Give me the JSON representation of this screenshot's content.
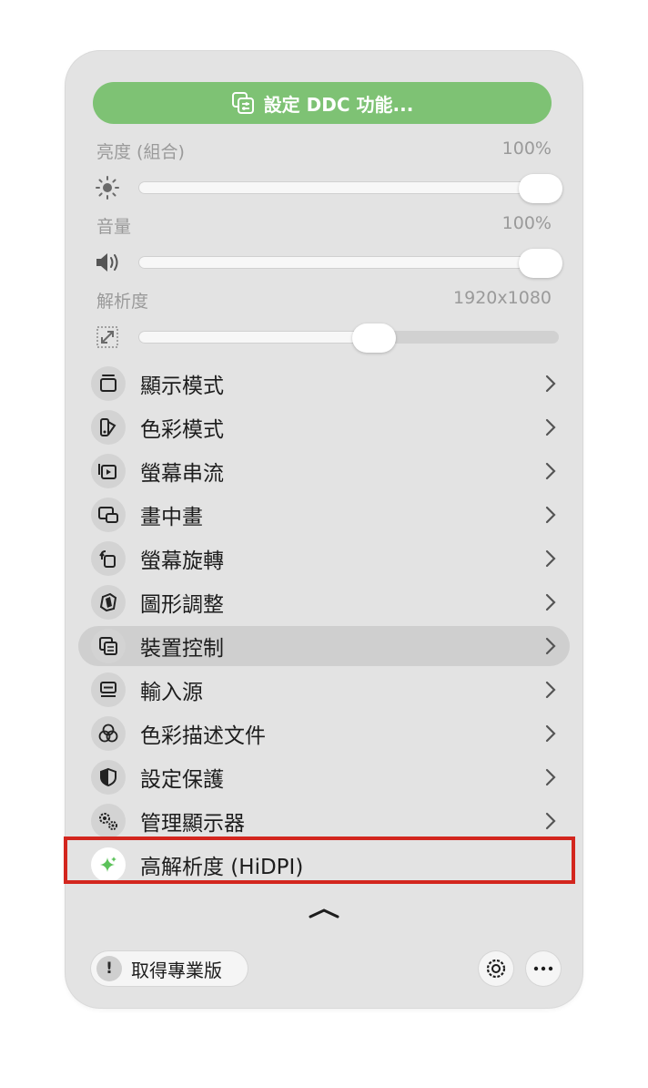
{
  "ddc_button": {
    "label": "設定 DDC 功能...",
    "icon": "ddc-settings-icon"
  },
  "brightness": {
    "label": "亮度 (組合)",
    "value": "100%",
    "level": 1.0,
    "icon": "sun-icon"
  },
  "volume": {
    "label": "音量",
    "value": "100%",
    "level": 1.0,
    "icon": "speaker-icon"
  },
  "resolution": {
    "label": "解析度",
    "value": "1920x1080",
    "level": 0.56,
    "icon": "resize-icon"
  },
  "menu": {
    "items": [
      {
        "label": "顯示模式",
        "icon": "display-mode-icon"
      },
      {
        "label": "色彩模式",
        "icon": "color-mode-icon"
      },
      {
        "label": "螢幕串流",
        "icon": "stream-icon"
      },
      {
        "label": "畫中畫",
        "icon": "picture-in-picture-icon"
      },
      {
        "label": "螢幕旋轉",
        "icon": "rotate-icon"
      },
      {
        "label": "圖形調整",
        "icon": "image-adjust-icon"
      },
      {
        "label": "裝置控制",
        "icon": "device-control-icon",
        "active": true
      },
      {
        "label": "輸入源",
        "icon": "input-source-icon"
      },
      {
        "label": "色彩描述文件",
        "icon": "color-profile-icon"
      },
      {
        "label": "設定保護",
        "icon": "shield-icon"
      },
      {
        "label": "管理顯示器",
        "icon": "gears-icon"
      },
      {
        "label": "高解析度 (HiDPI)",
        "icon": "sparkle-icon",
        "highlighted": true
      }
    ]
  },
  "footer": {
    "pro_label": "取得專業版",
    "settings_icon": "gear-icon",
    "more_icon": "ellipsis-icon"
  },
  "colors": {
    "accent_green": "#7ec274",
    "highlight_red": "#d3261e",
    "sparkle_green": "#5cc25a"
  }
}
